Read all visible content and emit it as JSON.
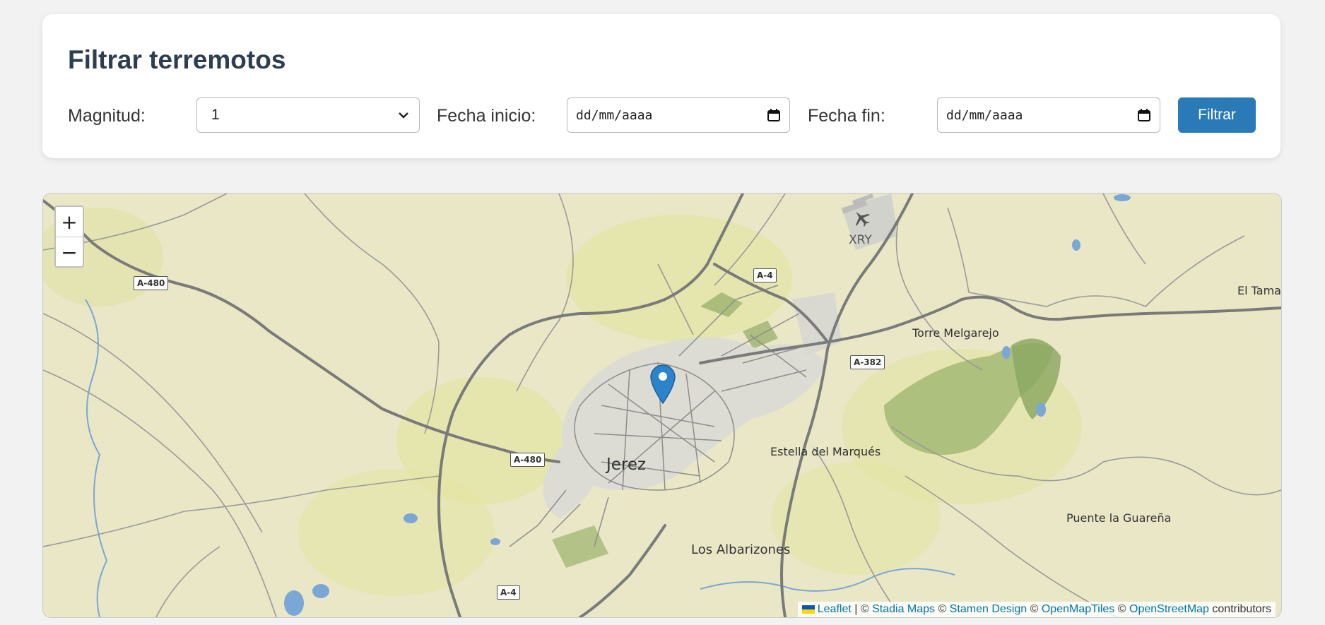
{
  "filter": {
    "title": "Filtrar terremotos",
    "magnitude_label": "Magnitud:",
    "magnitude_value": "1",
    "start_label": "Fecha inicio:",
    "start_placeholder": "dd/mm/aaaa",
    "end_label": "Fecha fin:",
    "end_placeholder": "dd/mm/aaaa",
    "button_label": "Filtrar"
  },
  "map": {
    "zoom_in": "+",
    "zoom_out": "−",
    "marker_icon": "map-pin-icon",
    "airport_icon": "airplane-icon",
    "places": {
      "jerez": "Jerez",
      "estella": "Estella del Marqués",
      "albarizones": "Los Albarizones",
      "torre": "Torre Melgarejo",
      "puente": "Puente la Guareña",
      "tamar": "El Tamar",
      "airport": "XRY"
    },
    "roads": {
      "a480_1": "A-480",
      "a480_2": "A-480",
      "a4_1": "A-4",
      "a4_2": "A-4",
      "a382": "A-382"
    },
    "attribution": {
      "leaflet": "Leaflet",
      "sep": "|",
      "c1": "©",
      "stadia": "Stadia Maps",
      "c2": "©",
      "stamen": "Stamen Design",
      "c3": "©",
      "openmaptiles": "OpenMapTiles",
      "c4": "©",
      "osm": "OpenStreetMap",
      "contributors": "contributors"
    },
    "colors": {
      "land": "#e9e7c6",
      "green": "#9bb36e",
      "water": "#7aa7d6",
      "marker": "#2a83cb",
      "road": "#7a7a7a"
    }
  }
}
